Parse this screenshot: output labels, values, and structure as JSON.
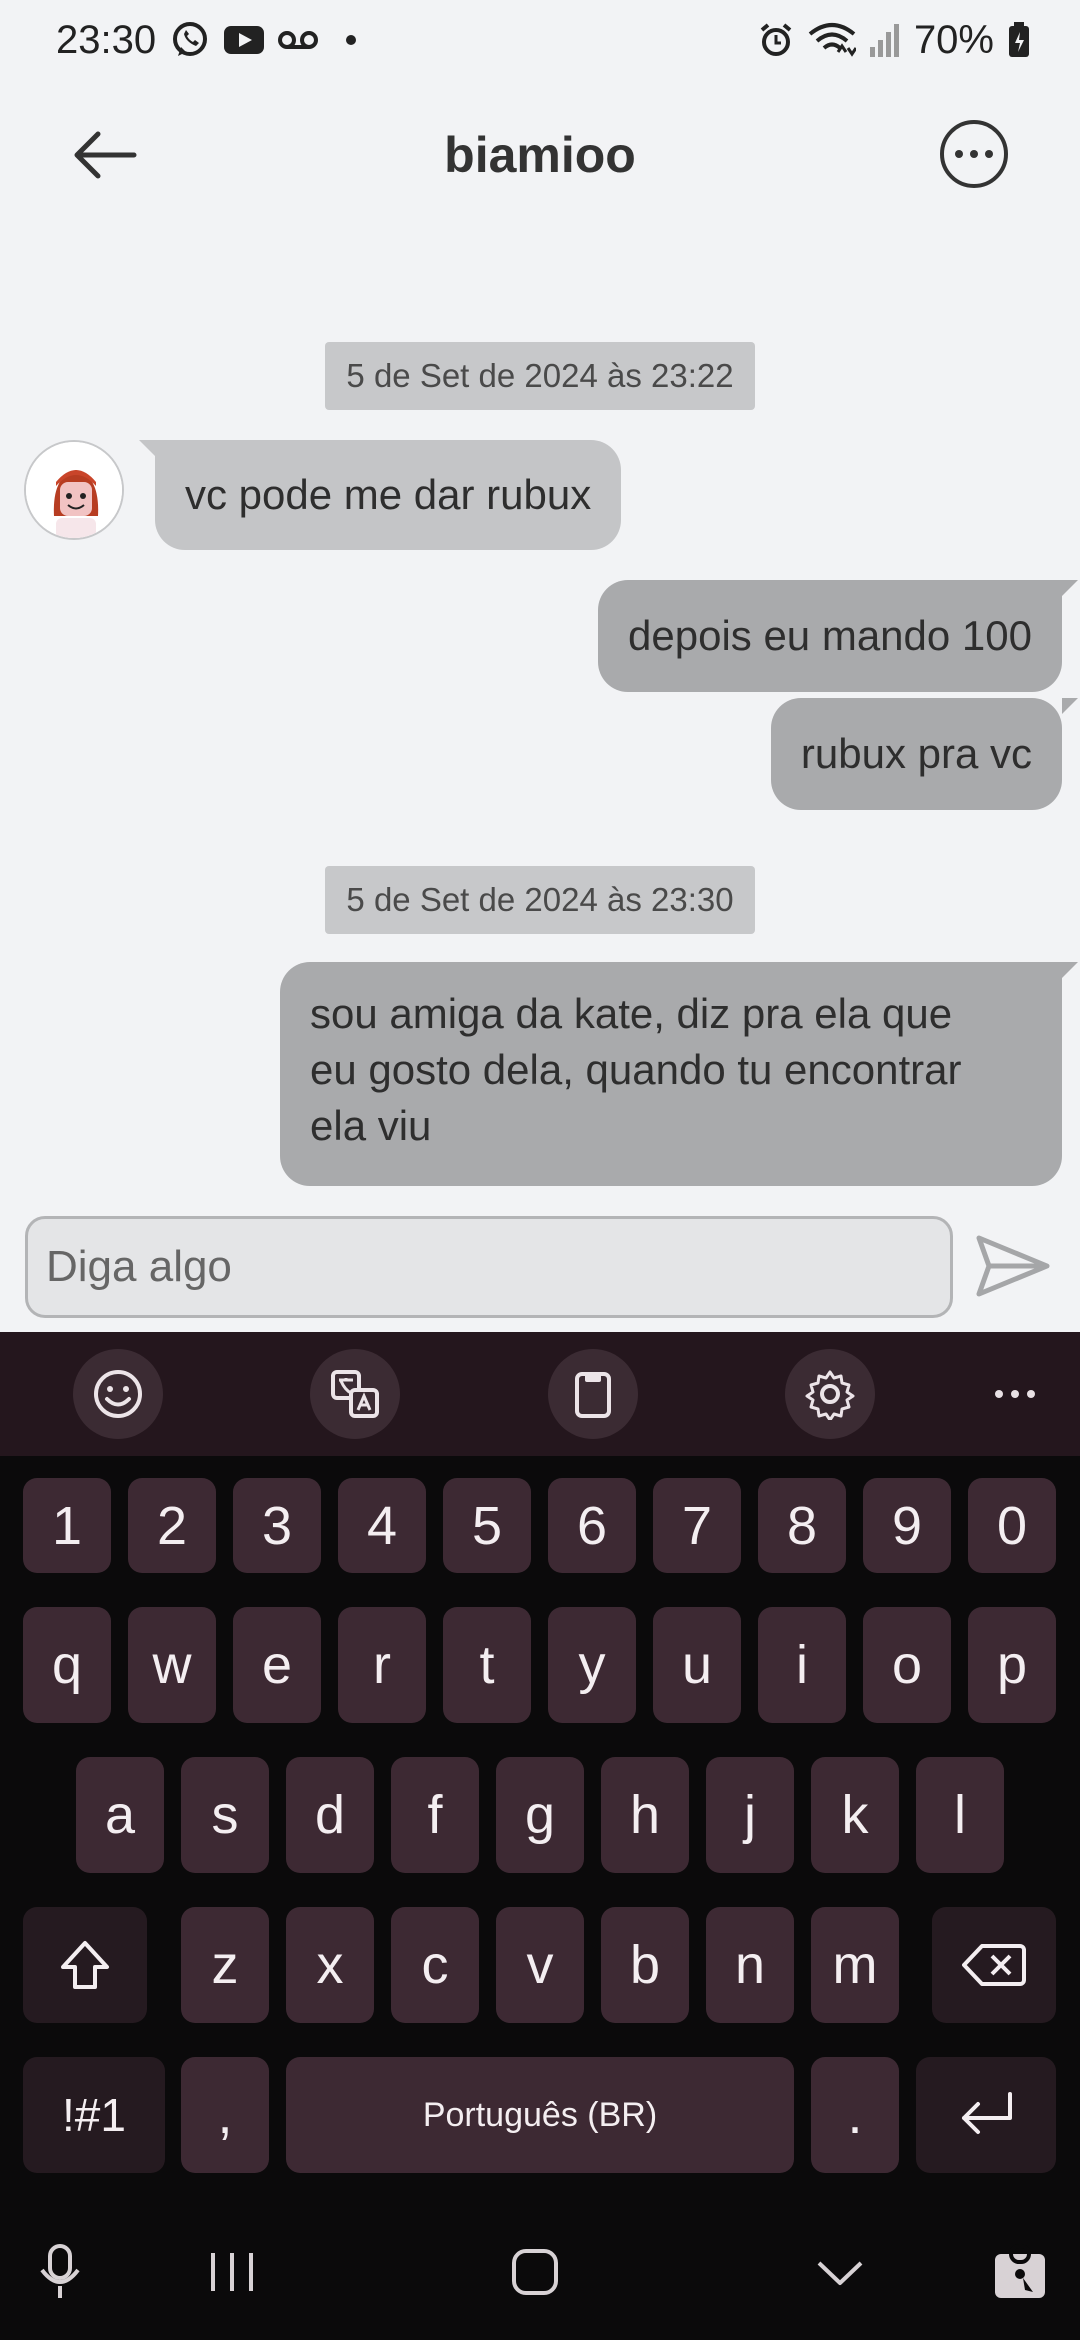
{
  "status_bar": {
    "time": "23:30",
    "battery": "70%",
    "left_icons": [
      "whatsapp-icon",
      "youtube-icon",
      "voicemail-icon",
      "dot"
    ],
    "right_icons": [
      "alarm-icon",
      "wifi-icon",
      "signal-icon",
      "battery-icon"
    ]
  },
  "header": {
    "title": "biamioo"
  },
  "messages": [
    {
      "type": "timestamp",
      "text": "5 de Set de 2024 às 23:22"
    },
    {
      "type": "incoming",
      "text": "vc pode me dar rubux"
    },
    {
      "type": "outgoing",
      "text": "depois eu mando 100"
    },
    {
      "type": "outgoing",
      "text": "rubux pra vc"
    },
    {
      "type": "timestamp",
      "text": "5 de Set de 2024 às 23:30"
    },
    {
      "type": "outgoing",
      "lines": [
        "sou amiga da kate, diz pra ela que",
        "eu gosto dela, quando tu encontrar",
        "ela viu"
      ]
    }
  ],
  "composer": {
    "placeholder": "Diga algo"
  },
  "keyboard": {
    "row_numbers": [
      "1",
      "2",
      "3",
      "4",
      "5",
      "6",
      "7",
      "8",
      "9",
      "0"
    ],
    "row1": [
      "q",
      "w",
      "e",
      "r",
      "t",
      "y",
      "u",
      "i",
      "o",
      "p"
    ],
    "row2": [
      "a",
      "s",
      "d",
      "f",
      "g",
      "h",
      "j",
      "k",
      "l"
    ],
    "row3": [
      "z",
      "x",
      "c",
      "v",
      "b",
      "n",
      "m"
    ],
    "symbols_key": "!#1",
    "comma_key": ",",
    "space_label": "Português (BR)",
    "period_key": ".",
    "toolbar": [
      "emoji-icon",
      "translate-icon",
      "clipboard-icon",
      "settings-icon",
      "more-icon"
    ]
  },
  "colors": {
    "background": "#f2f3f5",
    "bubble_out": "#a9aaac",
    "bubble_in": "#c4c5c7",
    "keyboard_bg": "#0b0a0b",
    "key_bg": "#3d2933"
  }
}
